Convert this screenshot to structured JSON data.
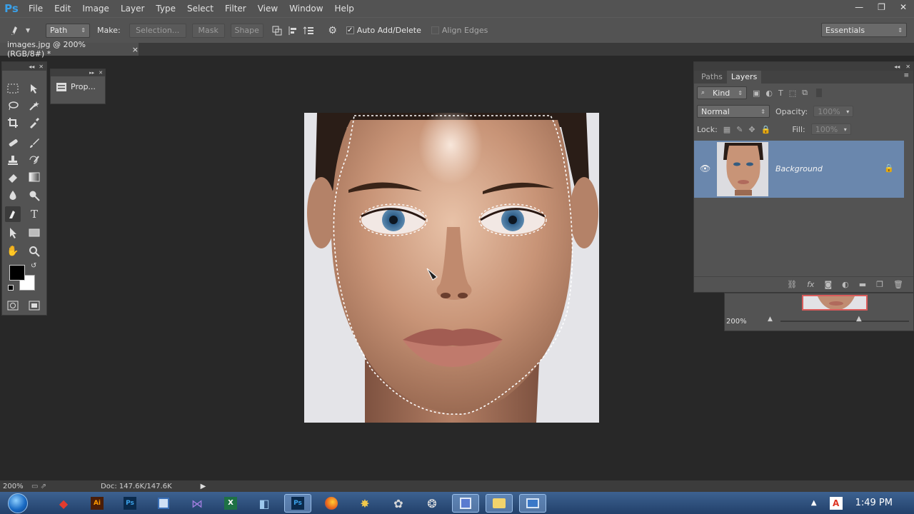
{
  "app": {
    "logo": "Ps"
  },
  "menu": [
    "File",
    "Edit",
    "Image",
    "Layer",
    "Type",
    "Select",
    "Filter",
    "View",
    "Window",
    "Help"
  ],
  "window_controls": {
    "minimize": "—",
    "restore": "❐",
    "close": "✕"
  },
  "options_bar": {
    "mode": "Path",
    "make_label": "Make:",
    "selection": "Selection...",
    "mask": "Mask",
    "shape": "Shape",
    "auto_add_delete": "Auto Add/Delete",
    "auto_add_delete_checked": true,
    "align_edges": "Align Edges",
    "align_edges_checked": false,
    "workspace": "Essentials"
  },
  "document_tab": {
    "title": "images.jpg @ 200% (RGB/8#) *",
    "close": "×"
  },
  "properties_panel": {
    "label": "Prop..."
  },
  "layers_panel": {
    "tabs": [
      "Paths",
      "Layers"
    ],
    "active_tab": "Layers",
    "filter_kind": "Kind",
    "blend_mode": "Normal",
    "opacity_label": "Opacity:",
    "opacity_value": "100%",
    "lock_label": "Lock:",
    "fill_label": "Fill:",
    "fill_value": "100%",
    "layers": [
      {
        "name": "Background",
        "visible": true,
        "locked": true
      }
    ]
  },
  "navigator": {
    "zoom": "200%"
  },
  "status_bar": {
    "zoom": "200%",
    "doc": "Doc: 147.6K/147.6K"
  },
  "taskbar": {
    "time": "1:49 PM"
  },
  "colors": {
    "accent": "#6a87ad",
    "ps_blue": "#3aa0e8",
    "foreground": "#000000",
    "background": "#ffffff"
  }
}
